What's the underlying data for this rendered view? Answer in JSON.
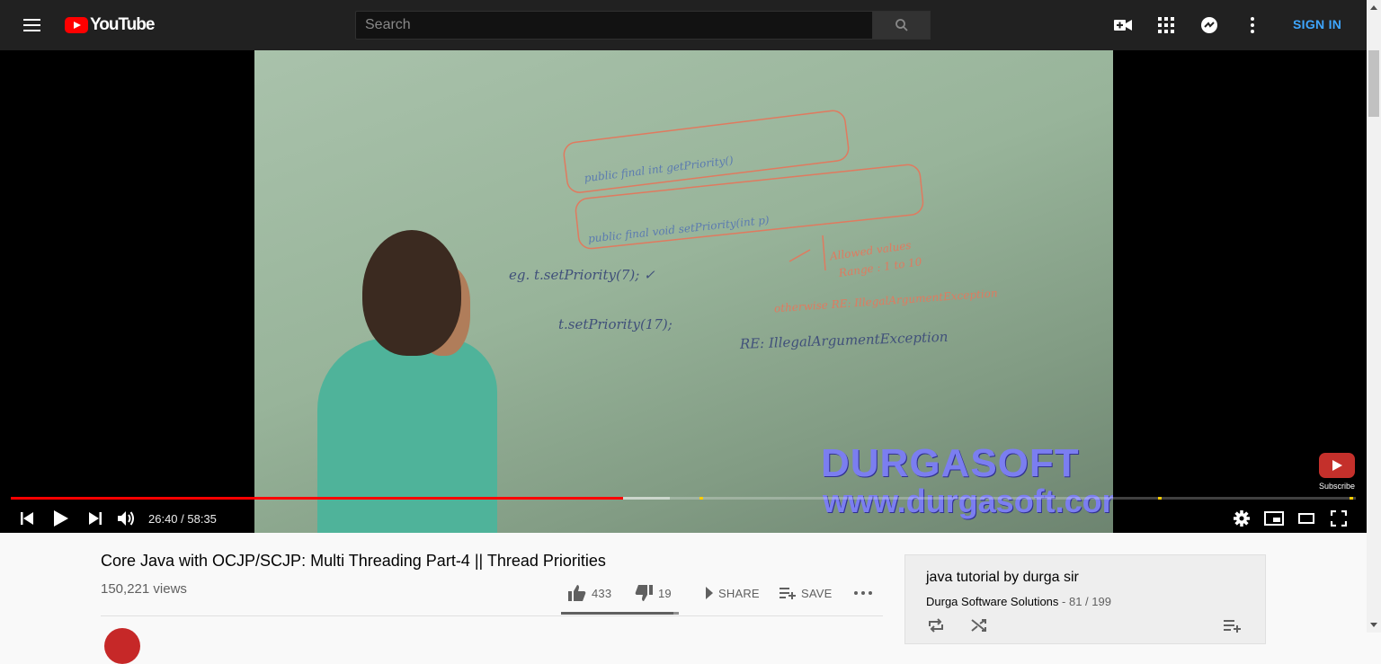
{
  "header": {
    "logo_text": "YouTube",
    "search_placeholder": "Search",
    "sign_in": "SIGN IN",
    "icons": [
      "menu-icon",
      "search-icon",
      "create-video-icon",
      "apps-icon",
      "messages-icon",
      "more-icon"
    ]
  },
  "player": {
    "time": "26:40 / 58:35",
    "progress_played_fraction": 0.455,
    "progress_loaded_fraction": 0.49,
    "watermark_brand": "DURGASOFT",
    "watermark_url": "www.durgasoft.com",
    "subscribe_label": "Subscribe",
    "board_lines": [
      "public final int getPriority()",
      "public final void setPriority(int p)",
      "Allowed values",
      "Range : 1 to 10",
      "otherwise RE: IllegalArgumentException",
      "eg. t.setPriority(7);",
      "t.setPriority(17);",
      "RE: IllegalArgumentException"
    ]
  },
  "video": {
    "title": "Core Java with OCJP/SCJP: Multi Threading Part-4 || Thread Priorities",
    "views": "150,221 views",
    "likes": "433",
    "dislikes": "19",
    "share": "SHARE",
    "save": "SAVE",
    "like_ratio": 0.958
  },
  "playlist": {
    "title": "java tutorial by durga sir",
    "channel": "Durga Software Solutions",
    "position": "81 / 199"
  },
  "colors": {
    "accent": "#ff0000",
    "link": "#3ea6ff",
    "ad_marker": "#ffcc00"
  }
}
